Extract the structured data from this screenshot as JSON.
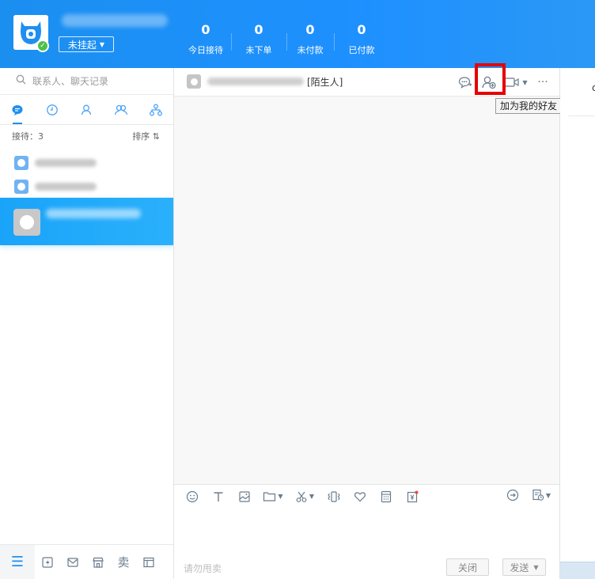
{
  "header": {
    "status": {
      "label": "未挂起"
    },
    "stats": [
      {
        "value": "0",
        "label": "今日接待"
      },
      {
        "value": "0",
        "label": "未下单"
      },
      {
        "value": "0",
        "label": "未付款"
      },
      {
        "value": "0",
        "label": "已付款"
      }
    ]
  },
  "sidebar": {
    "search": {
      "placeholder": "联系人、聊天记录"
    },
    "tabs": [
      "chat-bubble-icon",
      "clock-icon",
      "contact-icon",
      "group-icon",
      "org-tree-icon"
    ],
    "reception": {
      "label": "接待：3",
      "sort_label": "排序"
    },
    "bottom_icons": [
      "menu-icon",
      "bolt-icon",
      "mail-icon",
      "store-icon",
      "sell-icon",
      "panel-icon"
    ],
    "sell_label": "卖"
  },
  "chat": {
    "contact_tag": "[陌生人]",
    "tooltip": "加为我的好友",
    "input_placeholder": "请勿甩卖",
    "close_label": "关闭",
    "send_label": "发送"
  },
  "colors": {
    "header_blue": "#1e90ff",
    "active_chat": "#1aa4f9",
    "highlight_red": "#e60000"
  }
}
